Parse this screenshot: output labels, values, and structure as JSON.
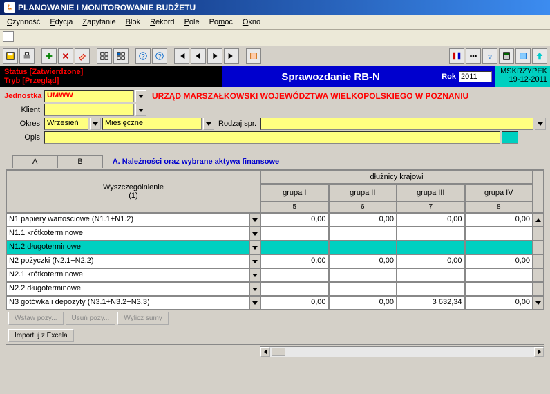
{
  "window": {
    "title": "PLANOWANIE I MONITOROWANIE BUDŻETU"
  },
  "menu": {
    "czynnosc": "Czynność",
    "edycja": "Edycja",
    "zapytanie": "Zapytanie",
    "blok": "Blok",
    "rekord": "Rekord",
    "pole": "Pole",
    "pomoc": "Pomoc",
    "okno": "Okno"
  },
  "status": {
    "line1": "Status [Zatwierdzone]",
    "line2": "Tryb [Przegląd]",
    "title": "Sprawozdanie RB-N",
    "rok_label": "Rok",
    "rok_value": "2011",
    "user": "MSKRZYPEK",
    "date": "19-12-2011"
  },
  "form": {
    "jednostka_label": "Jednostka",
    "jednostka_value": "UMWW",
    "header_text": "URZĄD MARSZAŁKOWSKI WOJEWÓDZTWA WIELKOPOLSKIEGO W POZNANIU",
    "klient_label": "Klient",
    "klient_value": "",
    "okres_label": "Okres",
    "okres_month": "Wrzesień",
    "okres_type": "Miesięczne",
    "rodzaj_label": "Rodzaj spr.",
    "rodzaj_value": "",
    "opis_label": "Opis",
    "opis_value": ""
  },
  "tabs": {
    "a": "A",
    "b": "B"
  },
  "section_title": "A. Należności oraz wybrane aktywa finansowe",
  "grid": {
    "col_wysz": "Wyszczególnienie",
    "col_wysz_num": "(1)",
    "col_dluz": "dłużnicy krajowi",
    "groups": [
      {
        "label": "grupa I",
        "num": "5"
      },
      {
        "label": "grupa II",
        "num": "6"
      },
      {
        "label": "grupa III",
        "num": "7"
      },
      {
        "label": "grupa IV",
        "num": "8"
      }
    ],
    "rows": [
      {
        "name": "N1 papiery wartościowe (N1.1+N1.2)",
        "vals": [
          "0,00",
          "0,00",
          "0,00",
          "0,00"
        ],
        "hl": false
      },
      {
        "name": "N1.1 krótkoterminowe",
        "vals": [
          "",
          "",
          "",
          ""
        ],
        "hl": false
      },
      {
        "name": "N1.2  długoterminowe",
        "vals": [
          "",
          "",
          "",
          ""
        ],
        "hl": true
      },
      {
        "name": "N2  pożyczki (N2.1+N2.2)",
        "vals": [
          "0,00",
          "0,00",
          "0,00",
          "0,00"
        ],
        "hl": false
      },
      {
        "name": "N2.1 krótkoterminowe",
        "vals": [
          "",
          "",
          "",
          ""
        ],
        "hl": false
      },
      {
        "name": "N2.2 długoterminowe",
        "vals": [
          "",
          "",
          "",
          ""
        ],
        "hl": false
      },
      {
        "name": "N3 gotówka i depozyty (N3.1+N3.2+N3.3)",
        "vals": [
          "0,00",
          "0,00",
          "3 632,34",
          "0,00"
        ],
        "hl": false
      }
    ]
  },
  "actions": {
    "wstaw": "Wstaw pozy...",
    "usun": "Usuń pozy...",
    "wylicz": "Wylicz sumy",
    "import": "Importuj z Excela"
  }
}
